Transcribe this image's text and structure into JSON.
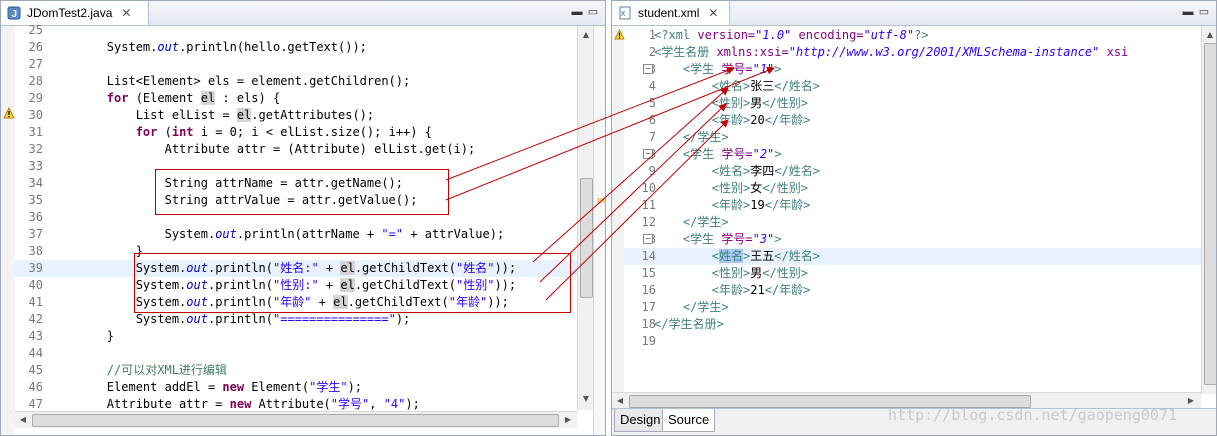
{
  "left_editor": {
    "tab_title": "JDomTest2.java",
    "lines": [
      {
        "n": "25",
        "parts": []
      },
      {
        "n": "26",
        "parts": [
          {
            "t": "        System."
          },
          {
            "t": "out",
            "c": "fld"
          },
          {
            "t": ".println(hello.getText());"
          }
        ]
      },
      {
        "n": "27",
        "parts": []
      },
      {
        "n": "28",
        "parts": [
          {
            "t": "        List<Element> els = element.getChildren();"
          }
        ]
      },
      {
        "n": "29",
        "parts": [
          {
            "t": "        "
          },
          {
            "t": "for",
            "c": "kw"
          },
          {
            "t": " (Element "
          },
          {
            "t": "el",
            "c": "hl"
          },
          {
            "t": " : els) {"
          }
        ]
      },
      {
        "n": "30",
        "parts": [
          {
            "t": "            List elList = "
          },
          {
            "t": "el",
            "c": "hl"
          },
          {
            "t": ".getAttributes();"
          }
        ]
      },
      {
        "n": "31",
        "parts": [
          {
            "t": "            "
          },
          {
            "t": "for",
            "c": "kw"
          },
          {
            "t": " ("
          },
          {
            "t": "int",
            "c": "kw"
          },
          {
            "t": " i = 0; i < elList.size(); i++) {"
          }
        ]
      },
      {
        "n": "32",
        "parts": [
          {
            "t": "                Attribute attr = (Attribute) elList.get(i);"
          }
        ]
      },
      {
        "n": "33",
        "parts": []
      },
      {
        "n": "34",
        "parts": [
          {
            "t": "                String attrName = attr.getName();"
          }
        ]
      },
      {
        "n": "35",
        "parts": [
          {
            "t": "                String attrValue = attr.getValue();"
          }
        ]
      },
      {
        "n": "36",
        "parts": []
      },
      {
        "n": "37",
        "parts": [
          {
            "t": "                System."
          },
          {
            "t": "out",
            "c": "fld"
          },
          {
            "t": ".println(attrName + "
          },
          {
            "t": "\"=\"",
            "c": "st"
          },
          {
            "t": " + attrValue);"
          }
        ]
      },
      {
        "n": "38",
        "parts": [
          {
            "t": "            }"
          }
        ]
      },
      {
        "n": "39",
        "parts": [
          {
            "t": "            System."
          },
          {
            "t": "out",
            "c": "fld"
          },
          {
            "t": ".println("
          },
          {
            "t": "\"姓名:\"",
            "c": "st"
          },
          {
            "t": " + "
          },
          {
            "t": "el",
            "c": "hl"
          },
          {
            "t": ".getChildText("
          },
          {
            "t": "\"姓名\"",
            "c": "st"
          },
          {
            "t": "));"
          }
        ],
        "current": true
      },
      {
        "n": "40",
        "parts": [
          {
            "t": "            System."
          },
          {
            "t": "out",
            "c": "fld"
          },
          {
            "t": ".println("
          },
          {
            "t": "\"性别:\"",
            "c": "st"
          },
          {
            "t": " + "
          },
          {
            "t": "el",
            "c": "hl"
          },
          {
            "t": ".getChildText("
          },
          {
            "t": "\"性别\"",
            "c": "st"
          },
          {
            "t": "));"
          }
        ]
      },
      {
        "n": "41",
        "parts": [
          {
            "t": "            System."
          },
          {
            "t": "out",
            "c": "fld"
          },
          {
            "t": ".println("
          },
          {
            "t": "\"年龄\"",
            "c": "st"
          },
          {
            "t": " + "
          },
          {
            "t": "el",
            "c": "hl"
          },
          {
            "t": ".getChildText("
          },
          {
            "t": "\"年龄\"",
            "c": "st"
          },
          {
            "t": "));"
          }
        ]
      },
      {
        "n": "42",
        "parts": [
          {
            "t": "            System."
          },
          {
            "t": "out",
            "c": "fld"
          },
          {
            "t": ".println("
          },
          {
            "t": "\"===============\"",
            "c": "st"
          },
          {
            "t": ");"
          }
        ]
      },
      {
        "n": "43",
        "parts": [
          {
            "t": "        }"
          }
        ]
      },
      {
        "n": "44",
        "parts": []
      },
      {
        "n": "45",
        "parts": [
          {
            "t": "        "
          },
          {
            "t": "//可以对XML进行编辑",
            "c": "cm"
          }
        ]
      },
      {
        "n": "46",
        "parts": [
          {
            "t": "        Element addEl = "
          },
          {
            "t": "new",
            "c": "kw"
          },
          {
            "t": " Element("
          },
          {
            "t": "\"学生\"",
            "c": "st"
          },
          {
            "t": ");"
          }
        ]
      },
      {
        "n": "47",
        "parts": [
          {
            "t": "        Attribute attr = "
          },
          {
            "t": "new",
            "c": "kw"
          },
          {
            "t": " Attribute("
          },
          {
            "t": "\"学号\"",
            "c": "st"
          },
          {
            "t": ", "
          },
          {
            "t": "\"4\"",
            "c": "st"
          },
          {
            "t": ");"
          }
        ]
      }
    ]
  },
  "right_editor": {
    "tab_title": "student.xml",
    "lines": [
      {
        "n": "1",
        "parts": [
          {
            "t": "<?xml ",
            "c": "xml-pi"
          },
          {
            "t": "version=",
            "c": "xml-attr"
          },
          {
            "t": "\"1.0\"",
            "c": "xml-val"
          },
          {
            "t": " encoding=",
            "c": "xml-attr"
          },
          {
            "t": "\"utf-8\"",
            "c": "xml-val"
          },
          {
            "t": "?>",
            "c": "xml-pi"
          }
        ]
      },
      {
        "n": "2",
        "parts": [
          {
            "t": "<学生名册 ",
            "c": "xml-tag"
          },
          {
            "t": "xmlns:xsi=",
            "c": "xml-attr"
          },
          {
            "t": "\"http://www.w3.org/2001/XMLSchema-instance\"",
            "c": "xml-val"
          },
          {
            "t": " xsi",
            "c": "xml-attr"
          }
        ]
      },
      {
        "n": "3",
        "parts": [
          {
            "t": "    <学生 ",
            "c": "xml-tag"
          },
          {
            "t": "学号=",
            "c": "xml-attr"
          },
          {
            "t": "\"1\"",
            "c": "xml-val"
          },
          {
            "t": ">",
            "c": "xml-tag"
          }
        ]
      },
      {
        "n": "4",
        "parts": [
          {
            "t": "        <姓名>",
            "c": "xml-tag"
          },
          {
            "t": "张三",
            "c": "xml-text"
          },
          {
            "t": "</姓名>",
            "c": "xml-tag"
          }
        ]
      },
      {
        "n": "5",
        "parts": [
          {
            "t": "        <性别>",
            "c": "xml-tag"
          },
          {
            "t": "男",
            "c": "xml-text"
          },
          {
            "t": "</性别>",
            "c": "xml-tag"
          }
        ]
      },
      {
        "n": "6",
        "parts": [
          {
            "t": "        <年龄>",
            "c": "xml-tag"
          },
          {
            "t": "20",
            "c": "xml-text"
          },
          {
            "t": "</年龄>",
            "c": "xml-tag"
          }
        ]
      },
      {
        "n": "7",
        "parts": [
          {
            "t": "    </学生>",
            "c": "xml-tag"
          }
        ]
      },
      {
        "n": "8",
        "parts": [
          {
            "t": "    <学生 ",
            "c": "xml-tag"
          },
          {
            "t": "学号=",
            "c": "xml-attr"
          },
          {
            "t": "\"2\"",
            "c": "xml-val"
          },
          {
            "t": ">",
            "c": "xml-tag"
          }
        ]
      },
      {
        "n": "9",
        "parts": [
          {
            "t": "        <姓名>",
            "c": "xml-tag"
          },
          {
            "t": "李四",
            "c": "xml-text"
          },
          {
            "t": "</姓名>",
            "c": "xml-tag"
          }
        ]
      },
      {
        "n": "10",
        "parts": [
          {
            "t": "        <性别>",
            "c": "xml-tag"
          },
          {
            "t": "女",
            "c": "xml-text"
          },
          {
            "t": "</性别>",
            "c": "xml-tag"
          }
        ]
      },
      {
        "n": "11",
        "parts": [
          {
            "t": "        <年龄>",
            "c": "xml-tag"
          },
          {
            "t": "19",
            "c": "xml-text"
          },
          {
            "t": "</年龄>",
            "c": "xml-tag"
          }
        ]
      },
      {
        "n": "12",
        "parts": [
          {
            "t": "    </学生>",
            "c": "xml-tag"
          }
        ]
      },
      {
        "n": "13",
        "parts": [
          {
            "t": "    <学生 ",
            "c": "xml-tag"
          },
          {
            "t": "学号=",
            "c": "xml-attr"
          },
          {
            "t": "\"3\"",
            "c": "xml-val"
          },
          {
            "t": ">",
            "c": "xml-tag"
          }
        ]
      },
      {
        "n": "14",
        "parts": [
          {
            "t": "        <",
            "c": "xml-tag"
          },
          {
            "t": "姓名",
            "c": "xml-tag sel"
          },
          {
            "t": ">",
            "c": "xml-tag"
          },
          {
            "t": "王五",
            "c": "xml-text"
          },
          {
            "t": "</姓名>",
            "c": "xml-tag"
          }
        ],
        "current": true
      },
      {
        "n": "15",
        "parts": [
          {
            "t": "        <性别>",
            "c": "xml-tag"
          },
          {
            "t": "男",
            "c": "xml-text"
          },
          {
            "t": "</性别>",
            "c": "xml-tag"
          }
        ]
      },
      {
        "n": "16",
        "parts": [
          {
            "t": "        <年龄>",
            "c": "xml-tag"
          },
          {
            "t": "21",
            "c": "xml-text"
          },
          {
            "t": "</年龄>",
            "c": "xml-tag"
          }
        ]
      },
      {
        "n": "17",
        "parts": [
          {
            "t": "    </学生>",
            "c": "xml-tag"
          }
        ]
      },
      {
        "n": "18",
        "parts": [
          {
            "t": "</学生名册>",
            "c": "xml-tag"
          }
        ]
      },
      {
        "n": "19",
        "parts": []
      }
    ],
    "bottom_tabs": [
      "Design",
      "Source"
    ],
    "active_bottom_tab": "Source"
  },
  "watermark": "http://blog.csdn.net/gaopeng0071",
  "colors": {
    "annotation_red": "#c00000",
    "current_line": "#e8f2fe",
    "selection": "#d4d4d4"
  },
  "icons": [
    "java-file-icon",
    "xml-file-icon",
    "close-icon",
    "minimize-icon",
    "maximize-icon",
    "warning-icon",
    "fold-icon",
    "scroll-arrow-icon"
  ]
}
